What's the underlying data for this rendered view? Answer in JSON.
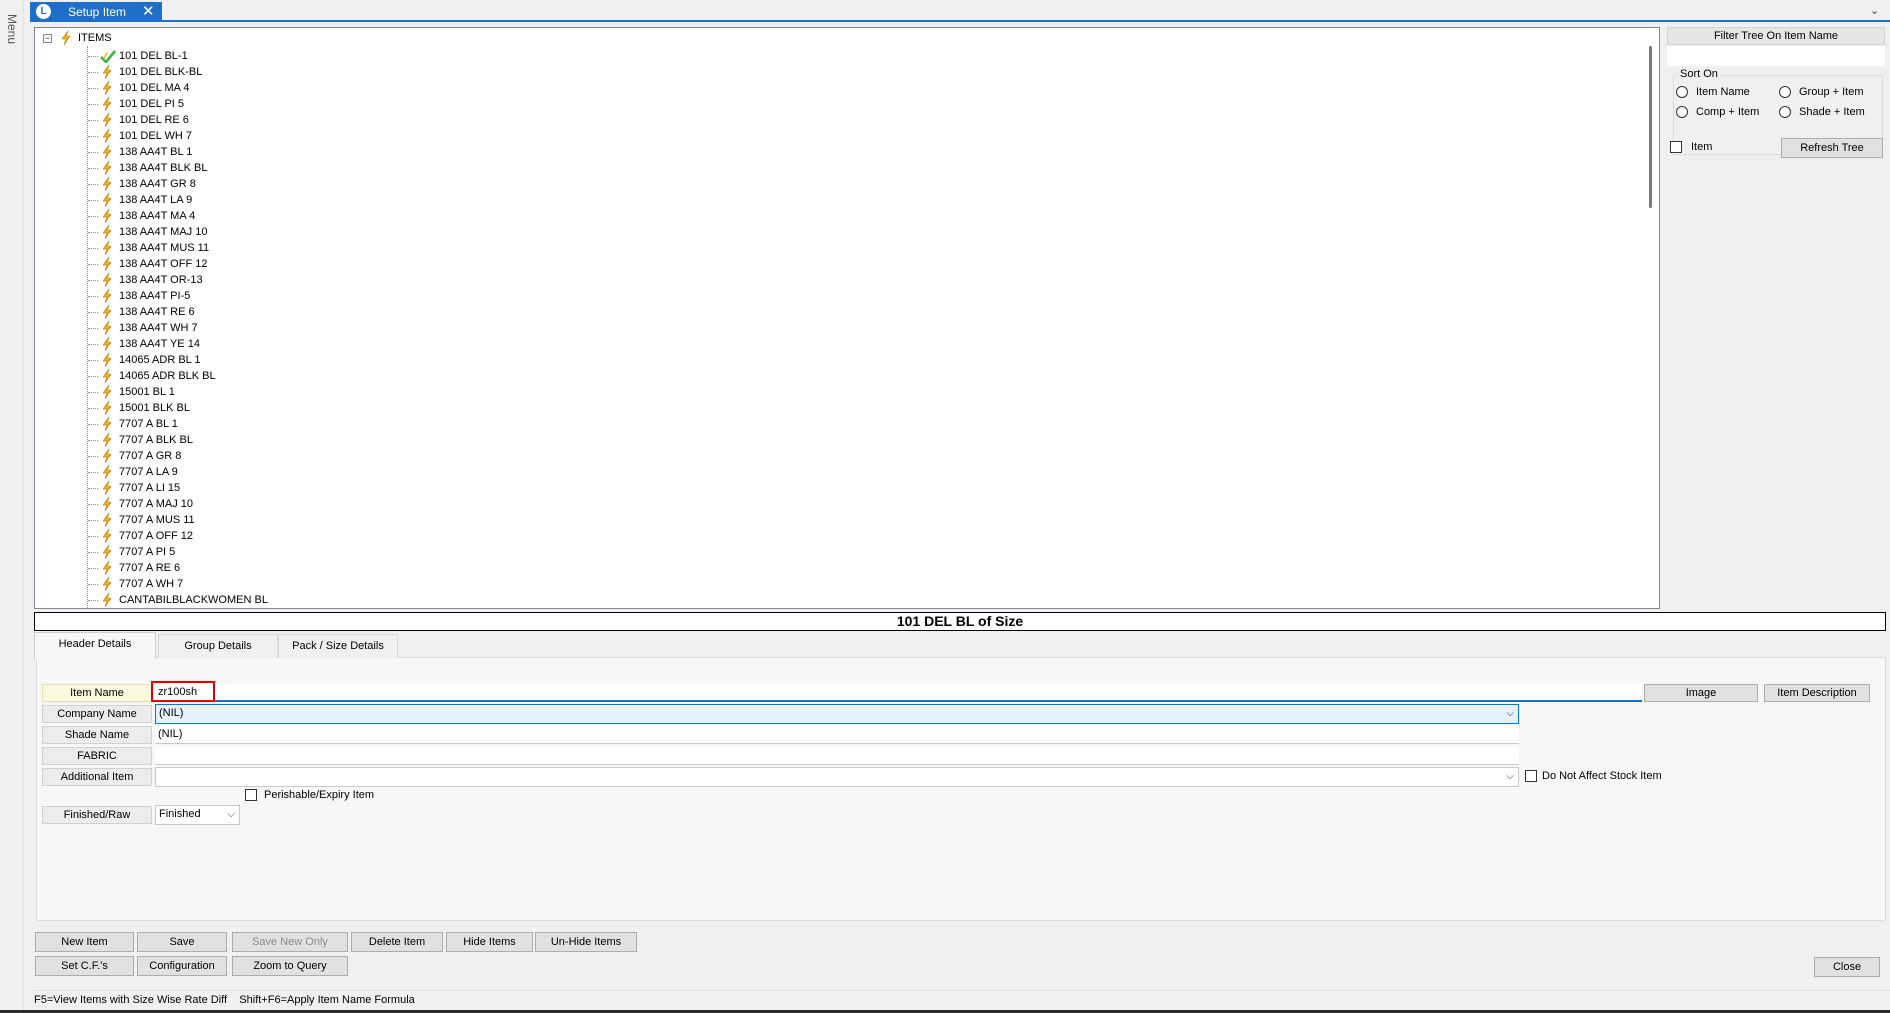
{
  "menu_label": "Menu",
  "tab": {
    "icon": "L",
    "title": "Setup Item",
    "close": "✕"
  },
  "window_chevron": "⌄",
  "tree": {
    "root_expander": "−",
    "root": "ITEMS",
    "items": [
      {
        "label": "101 DEL BL-1",
        "icon": "check-icon"
      },
      {
        "label": "101 DEL BLK-BL",
        "icon": "bolt-icon"
      },
      {
        "label": "101 DEL MA 4",
        "icon": "bolt-icon"
      },
      {
        "label": "101 DEL PI 5",
        "icon": "bolt-icon"
      },
      {
        "label": "101 DEL RE 6",
        "icon": "bolt-icon"
      },
      {
        "label": "101 DEL WH 7",
        "icon": "bolt-icon"
      },
      {
        "label": "138 AA4T BL 1",
        "icon": "bolt-icon"
      },
      {
        "label": "138 AA4T BLK BL",
        "icon": "bolt-icon"
      },
      {
        "label": "138 AA4T GR 8",
        "icon": "bolt-icon"
      },
      {
        "label": "138 AA4T LA 9",
        "icon": "bolt-icon"
      },
      {
        "label": "138 AA4T MA 4",
        "icon": "bolt-icon"
      },
      {
        "label": "138 AA4T MAJ 10",
        "icon": "bolt-icon"
      },
      {
        "label": "138 AA4T MUS 11",
        "icon": "bolt-icon"
      },
      {
        "label": "138 AA4T OFF 12",
        "icon": "bolt-icon"
      },
      {
        "label": "138 AA4T OR-13",
        "icon": "bolt-icon"
      },
      {
        "label": "138 AA4T PI-5",
        "icon": "bolt-icon"
      },
      {
        "label": "138 AA4T RE 6",
        "icon": "bolt-icon"
      },
      {
        "label": "138 AA4T WH 7",
        "icon": "bolt-icon"
      },
      {
        "label": "138 AA4T YE 14",
        "icon": "bolt-icon"
      },
      {
        "label": "14065 ADR BL 1",
        "icon": "bolt-icon"
      },
      {
        "label": "14065 ADR BLK BL",
        "icon": "bolt-icon"
      },
      {
        "label": "15001 BL 1",
        "icon": "bolt-icon"
      },
      {
        "label": "15001 BLK BL",
        "icon": "bolt-icon"
      },
      {
        "label": "7707 A BL 1",
        "icon": "bolt-icon"
      },
      {
        "label": "7707 A BLK BL",
        "icon": "bolt-icon"
      },
      {
        "label": "7707 A GR 8",
        "icon": "bolt-icon"
      },
      {
        "label": "7707 A LA 9",
        "icon": "bolt-icon"
      },
      {
        "label": "7707 A LI 15",
        "icon": "bolt-icon"
      },
      {
        "label": "7707 A MAJ 10",
        "icon": "bolt-icon"
      },
      {
        "label": "7707 A MUS 11",
        "icon": "bolt-icon"
      },
      {
        "label": "7707 A OFF 12",
        "icon": "bolt-icon"
      },
      {
        "label": "7707 A PI 5",
        "icon": "bolt-icon"
      },
      {
        "label": "7707 A RE 6",
        "icon": "bolt-icon"
      },
      {
        "label": "7707 A WH 7",
        "icon": "bolt-icon"
      },
      {
        "label": "CANTABILBLACKWOMEN BL",
        "icon": "bolt-icon"
      }
    ]
  },
  "filter": {
    "title": "Filter Tree On Item Name",
    "input_value": "",
    "sort_legend": "Sort On",
    "options": [
      "Item Name",
      "Group + Item",
      "Comp + Item",
      "Shade + Item"
    ],
    "item_checkbox_label": "Item",
    "refresh_button": "Refresh Tree"
  },
  "item_title": "101 DEL BL  of Size",
  "tabs": [
    "Header Details",
    "Group Details",
    "Pack / Size Details"
  ],
  "form": {
    "item_name_label": "Item Name",
    "item_name_value": "zr100sh",
    "image_button": "Image",
    "item_description_button": "Item Description",
    "company_name_label": "Company Name",
    "company_name_value": "(NIL)",
    "shade_name_label": "Shade Name",
    "shade_name_value": "(NIL)",
    "fabric_label": "FABRIC",
    "fabric_value": "",
    "additional_item_label": "Additional Item",
    "additional_item_value": "",
    "do_not_affect_label": "Do Not Affect Stock Item",
    "perishable_label": "Perishable/Expiry Item",
    "finished_raw_label": "Finished/Raw",
    "finished_raw_value": "Finished",
    "dropdown_arrow": "⌵"
  },
  "buttons": {
    "new_item": "New Item",
    "save": "Save",
    "save_new_only": "Save New Only",
    "delete_item": "Delete Item",
    "hide_items": "Hide Items",
    "unhide_items": "Un-Hide Items",
    "set_cfs": "Set C.F.'s",
    "configuration": "Configuration",
    "zoom_to_query": "Zoom to Query",
    "close": "Close"
  },
  "status_bar": "F5=View Items with Size Wise Rate Diff    Shift+F6=Apply Item Name Formula",
  "colors": {
    "accent": "#1e6fc8",
    "bolt": "#f2b31a",
    "check": "#3fb23f",
    "highlight_border": "#e00000"
  }
}
